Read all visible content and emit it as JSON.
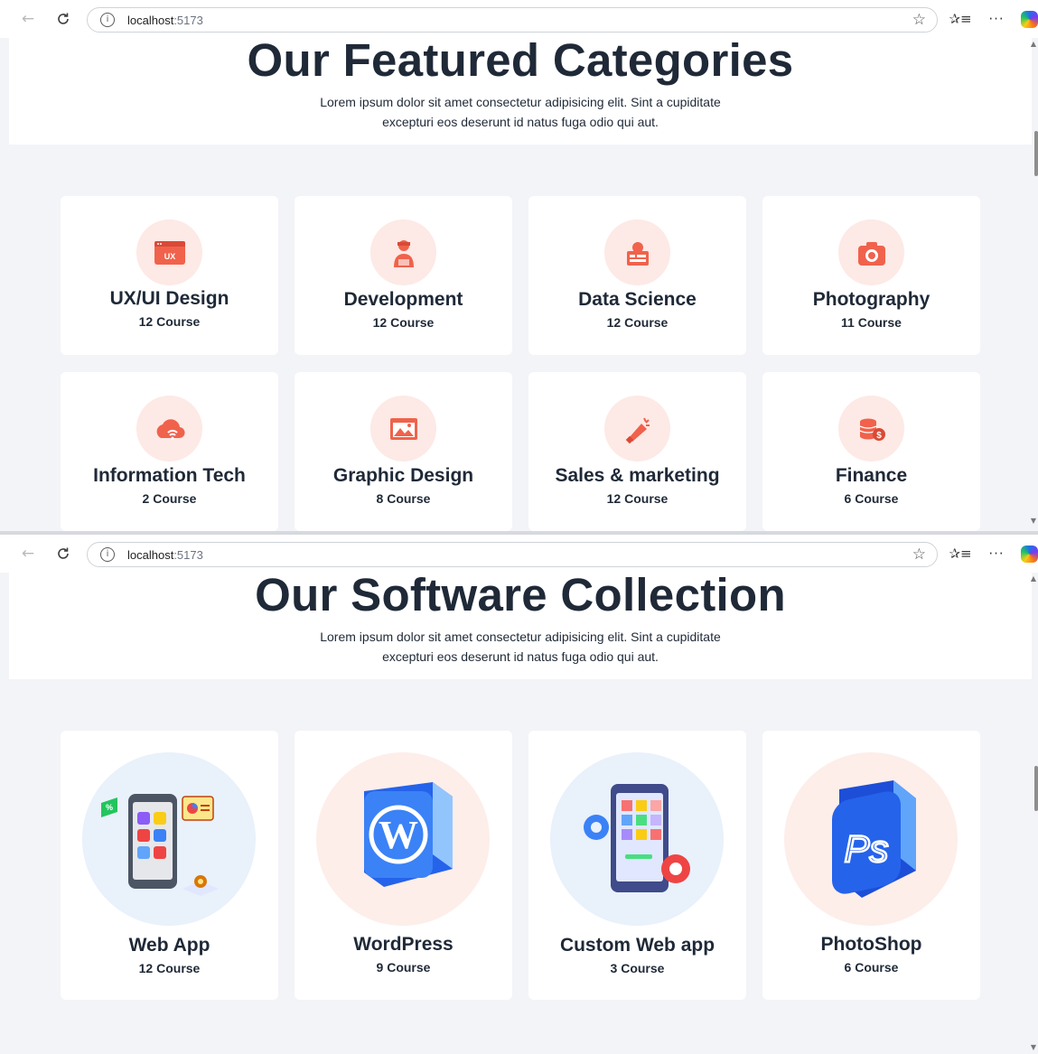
{
  "browser": {
    "url_host": "localhost",
    "url_port": ":5173",
    "back_icon": "←",
    "reload_icon": "C",
    "info_icon": "i",
    "star_icon": "☆",
    "favorites_icon": "✰≡",
    "more_icon": "···"
  },
  "featured": {
    "title": "Our Featured Categories",
    "description": "Lorem ipsum dolor sit amet consectetur adipisicing elit. Sint a cupiditate excepturi eos deserunt id natus fuga odio qui aut.",
    "cards": [
      {
        "title": "UX/UI Design",
        "count": "12 Course",
        "icon": "ux-window-icon"
      },
      {
        "title": "Development",
        "count": "12 Course",
        "icon": "developer-icon"
      },
      {
        "title": "Data Science",
        "count": "12 Course",
        "icon": "data-science-icon"
      },
      {
        "title": "Photography",
        "count": "11 Course",
        "icon": "camera-icon"
      },
      {
        "title": "Information Tech",
        "count": "2 Course",
        "icon": "cloud-wifi-icon"
      },
      {
        "title": "Graphic Design",
        "count": "8 Course",
        "icon": "graphic-design-icon"
      },
      {
        "title": "Sales & marketing",
        "count": "12 Course",
        "icon": "megaphone-icon"
      },
      {
        "title": "Finance",
        "count": "6 Course",
        "icon": "coins-icon"
      }
    ]
  },
  "software": {
    "title": "Our Software Collection",
    "description": "Lorem ipsum dolor sit amet consectetur adipisicing elit. Sint a cupiditate excepturi eos deserunt id natus fuga odio qui aut.",
    "cards": [
      {
        "title": "Web App",
        "count": "12 Course",
        "icon": "mobile-web-app-icon"
      },
      {
        "title": "WordPress",
        "count": "9 Course",
        "icon": "wordpress-icon"
      },
      {
        "title": "Custom Web app",
        "count": "3 Course",
        "icon": "custom-app-icon"
      },
      {
        "title": "PhotoShop",
        "count": "6 Course",
        "icon": "photoshop-icon",
        "logo_text": "Ps"
      }
    ]
  },
  "colors": {
    "icon_accent": "#f0624c",
    "icon_bg": "#fde9e5",
    "page_bg": "#f3f4f8",
    "heading": "#1f2937"
  }
}
